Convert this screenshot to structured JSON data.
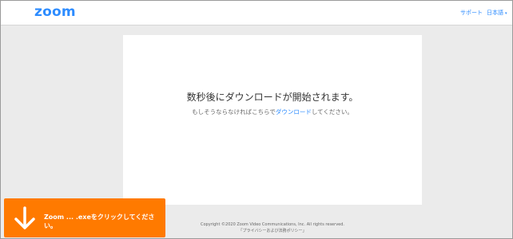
{
  "header": {
    "logo": "zoom",
    "support_link": "サポート",
    "language_link": "日本語",
    "language_caret": "▾"
  },
  "main": {
    "headline": "数秒後にダウンロードが開始されます。",
    "subline_prefix": "もしそうならなければこちらで",
    "subline_link": "ダウンロード",
    "subline_suffix": "してください。"
  },
  "footer": {
    "copyright": "Copyright ©2020 Zoom Video Communications, Inc. All rights reserved.",
    "privacy_link": "「プライバシーおよび法務ポリシー」"
  },
  "toast": {
    "icon": "download-arrow-icon",
    "text": "Zoom ... .exeをクリックしてください。",
    "background": "#ff7a00"
  },
  "colors": {
    "brand": "#2d8cff",
    "page_bg": "#ebebeb"
  }
}
